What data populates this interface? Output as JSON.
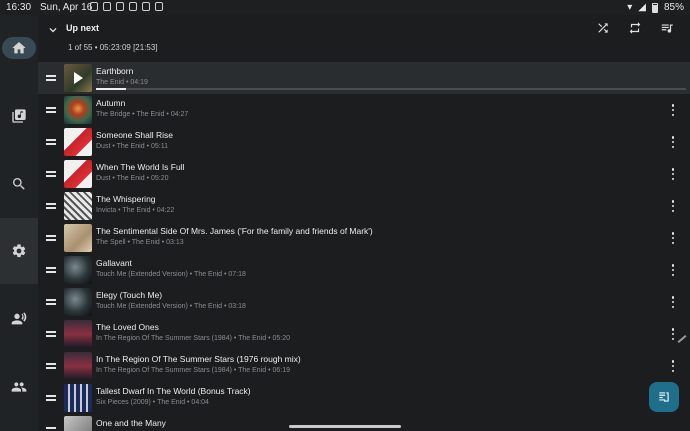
{
  "status_bar": {
    "time": "16:30",
    "date": "Sun, Apr 16",
    "battery": "85%"
  },
  "rail": {
    "items": [
      {
        "name": "home",
        "icon": "home-icon",
        "active": true
      },
      {
        "name": "library",
        "icon": "music-library-icon",
        "active": false
      },
      {
        "name": "search",
        "icon": "search-icon",
        "active": false
      },
      {
        "name": "settings",
        "icon": "gear-icon",
        "active": true
      },
      {
        "name": "people",
        "icon": "people-icon",
        "active": false
      },
      {
        "name": "people-2",
        "icon": "people-icon",
        "active": false
      }
    ]
  },
  "queue_header": {
    "title": "Up next",
    "summary": "1 of 55 • 05:23:09 [21:53]"
  },
  "queue": [
    {
      "title": "Earthborn",
      "subtitle": "The Enid • 04:19",
      "current": true,
      "progress": 0.05
    },
    {
      "title": "Autumn",
      "subtitle": "The Bridge • The Enid • 04:27"
    },
    {
      "title": "Someone Shall Rise",
      "subtitle": "Dust • The Enid • 05:11"
    },
    {
      "title": "When The World Is Full",
      "subtitle": "Dust • The Enid • 05:20"
    },
    {
      "title": "The Whispering",
      "subtitle": "Invicta • The Enid • 04:22"
    },
    {
      "title": "The Sentimental Side Of Mrs. James ('For the family and friends of Mark')",
      "subtitle": "The Spell • The Enid • 03:13"
    },
    {
      "title": "Gallavant",
      "subtitle": "Touch Me (Extended Version) • The Enid • 07:18"
    },
    {
      "title": "Elegy (Touch Me)",
      "subtitle": "Touch Me (Extended Version) • The Enid • 03:18"
    },
    {
      "title": "The Loved Ones",
      "subtitle": "In The Region Of The Summer Stars (1984) • The Enid • 05:20"
    },
    {
      "title": "In The Region Of The Summer Stars (1976 rough mix)",
      "subtitle": "In The Region Of The Summer Stars (1984) • The Enid • 06:19"
    },
    {
      "title": "Tallest Dwarf In The World (Bonus Track)",
      "subtitle": "Six Pieces (2009) • The Enid • 04:04"
    },
    {
      "title": "One and the Many",
      "subtitle": ""
    }
  ],
  "colors": {
    "background": "#1b1d1f",
    "rail": "#202326",
    "accent_fab": "#1f6f8a",
    "current_row": "#2a2d30"
  }
}
